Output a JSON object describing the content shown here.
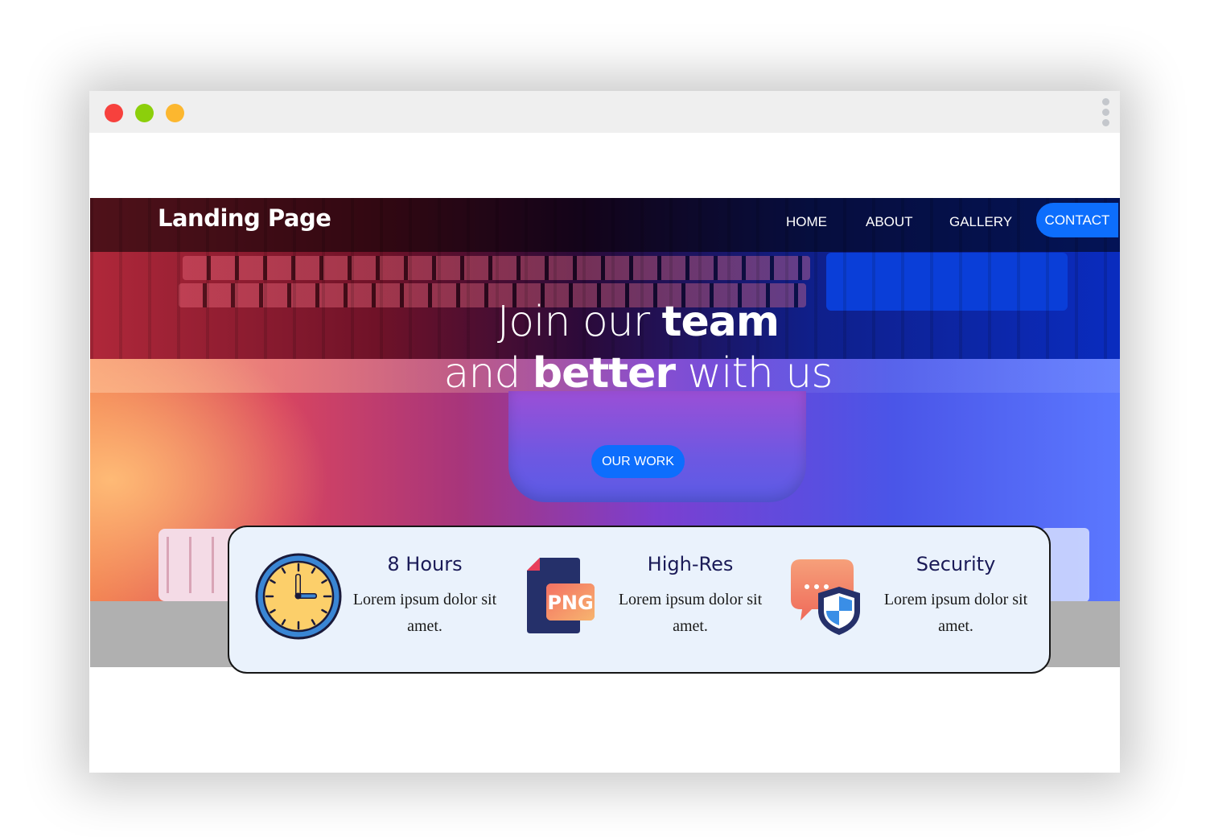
{
  "window": {
    "controls": [
      "close-dot",
      "minimize-dot",
      "maximize-dot"
    ],
    "menu_icon": "vertical-ellipsis-icon"
  },
  "navbar": {
    "brand": "Landing Page",
    "items": [
      "HOME",
      "ABOUT",
      "GALLERY"
    ],
    "contact_label": "CONTACT"
  },
  "hero": {
    "line1_light": "Join our ",
    "line1_bold": "team",
    "line2_light_before": "and ",
    "line2_bold": "better",
    "line2_light_after": " with us",
    "cta_label": "OUR WORK"
  },
  "features": [
    {
      "icon": "clock-icon",
      "title": "8 Hours",
      "description": "Lorem ipsum dolor sit amet."
    },
    {
      "icon": "png-file-icon",
      "icon_text": "PNG",
      "title": "High-Res",
      "description": "Lorem ipsum dolor sit amet."
    },
    {
      "icon": "security-shield-chat-icon",
      "title": "Security",
      "description": "Lorem ipsum dolor sit amet."
    }
  ],
  "colors": {
    "accent": "#0d6efd",
    "title_text": "#1a1a57",
    "card_bg": "#eaf2fc"
  }
}
